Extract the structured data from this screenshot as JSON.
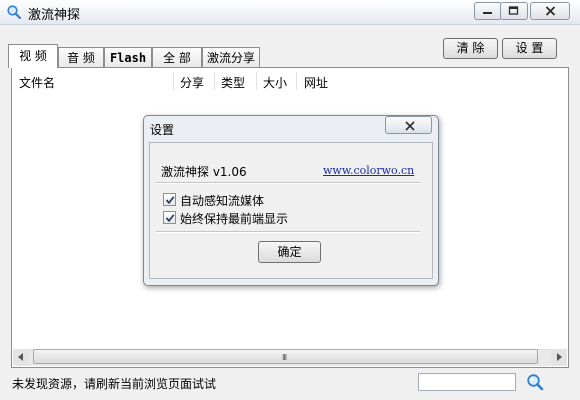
{
  "window": {
    "title": "激流神探"
  },
  "tabs": [
    {
      "label": "视 频",
      "active": true
    },
    {
      "label": "音 频",
      "active": false
    },
    {
      "label": "Flash",
      "active": false
    },
    {
      "label": "全 部",
      "active": false
    },
    {
      "label": "激流分享",
      "active": false
    }
  ],
  "toolbar": {
    "clear_label": "清 除",
    "settings_label": "设 置"
  },
  "list": {
    "columns": [
      "文件名",
      "分享",
      "类型",
      "大小",
      "网址"
    ],
    "rows": []
  },
  "scrollbar": {
    "grip": "III"
  },
  "status": {
    "text": "未发现资源，请刷新当前浏览页面试试",
    "search_value": ""
  },
  "dialog": {
    "title": "设置",
    "app_version": "激流神探 v1.06",
    "link": "www.colorwo.cn",
    "options": [
      {
        "label": "自动感知流媒体",
        "checked": true
      },
      {
        "label": "始终保持最前端显示",
        "checked": true
      }
    ],
    "ok_label": "确定"
  },
  "colors": {
    "link": "#1b2ba6",
    "accent": "#2f7fd4"
  }
}
